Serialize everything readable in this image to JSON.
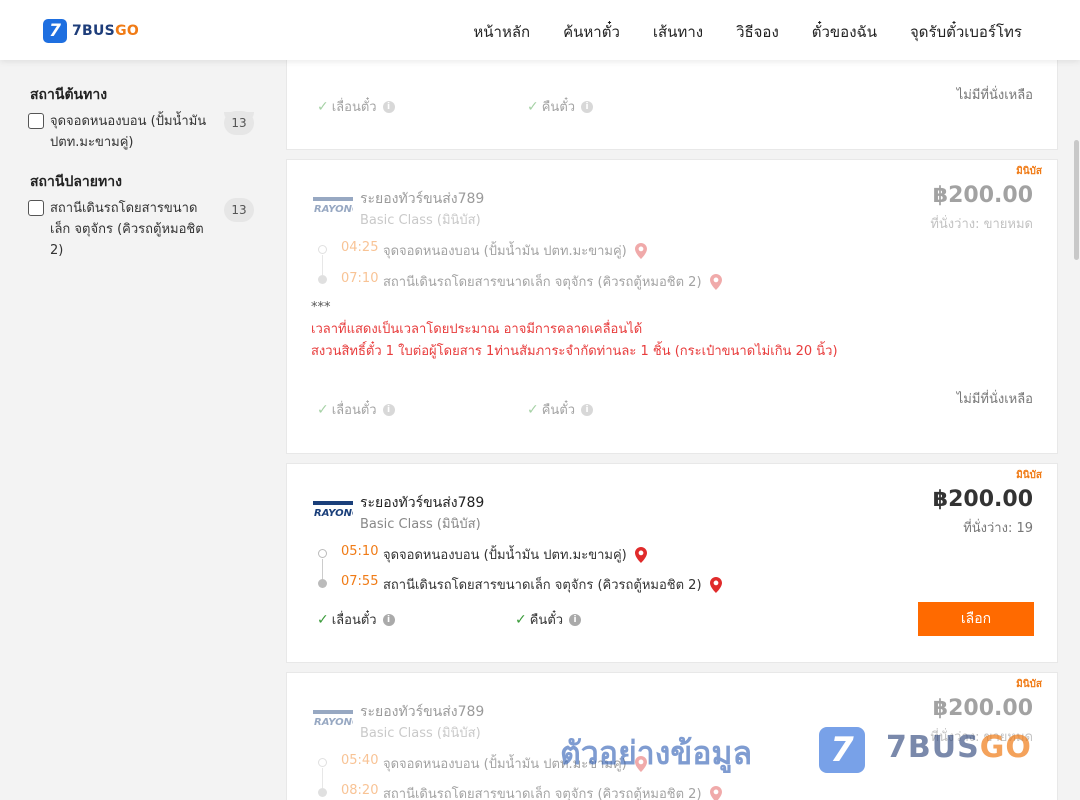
{
  "header": {
    "logo_text_main": "7BUS",
    "logo_text_accent": "GO",
    "logo_badge": "7",
    "nav": [
      "หน้าหลัก",
      "ค้นหาตั๋ว",
      "เส้นทาง",
      "วิธีจอง",
      "ตั๋วของฉัน",
      "จุดรับตั๋วเบอร์โทร"
    ]
  },
  "sidebar": {
    "origin_title": "สถานีต้นทาง",
    "origin_option": "จุดจอดหนองบอน (ปั้มน้ำมัน ปตท.มะขามคู่)",
    "origin_count": "13",
    "dest_title": "สถานีปลายทาง",
    "dest_option": "สถานีเดินรถโดยสารขนาดเล็ก จตุจักร (คิวรถตู้หมอชิต 2)",
    "dest_count": "13"
  },
  "cards": [
    {
      "reschedule": "เลื่อนตั๋ว",
      "refund": "คืนตั๋ว",
      "seat_status": "ไม่มีที่นั่งเหลือ"
    },
    {
      "badge": "มินิบัส",
      "operator": "ระยองทัวร์ขนส่ง789",
      "class": "Basic Class (มินิบัส)",
      "price": "฿200.00",
      "seats": "ที่นั่งว่าง: ขายหมด",
      "depart_time": "04:25",
      "depart_stop": "จุดจอดหนองบอน (ปั้มน้ำมัน ปตท.มะขามคู่)",
      "arrive_time": "07:10",
      "arrive_stop": "สถานีเดินรถโดยสารขนาดเล็ก จตุจักร (คิวรถตู้หมอชิต 2)",
      "note_stars": "***",
      "note_line1": "เวลาที่แสดงเป็นเวลาโดยประมาณ อาจมีการคลาดเคลื่อนได้",
      "note_line2": "สงวนสิทธิ์ตั๋ว 1 ใบต่อผู้โดยสาร 1ท่านสัมภาระจำกัดท่านละ 1 ชิ้น (กระเป๋าขนาดไม่เกิน 20 นิ้ว)",
      "reschedule": "เลื่อนตั๋ว",
      "refund": "คืนตั๋ว",
      "seat_status": "ไม่มีที่นั่งเหลือ"
    },
    {
      "badge": "มินิบัส",
      "operator": "ระยองทัวร์ขนส่ง789",
      "class": "Basic Class (มินิบัส)",
      "price": "฿200.00",
      "seats": "ที่นั่งว่าง: 19",
      "depart_time": "05:10",
      "depart_stop": "จุดจอดหนองบอน (ปั้มน้ำมัน ปตท.มะขามคู่)",
      "arrive_time": "07:55",
      "arrive_stop": "สถานีเดินรถโดยสารขนาดเล็ก จตุจักร (คิวรถตู้หมอชิต 2)",
      "reschedule": "เลื่อนตั๋ว",
      "refund": "คืนตั๋ว",
      "select_label": "เลือก"
    },
    {
      "badge": "มินิบัส",
      "operator": "ระยองทัวร์ขนส่ง789",
      "class": "Basic Class (มินิบัส)",
      "price": "฿200.00",
      "seats": "ที่นั่งว่าง: ขายหมด",
      "depart_time": "05:40",
      "depart_stop": "จุดจอดหนองบอน (ปั้มน้ำมัน ปตท.มะขามคู่)",
      "arrive_time": "08:20",
      "arrive_stop": "สถานีเดินรถโดยสารขนาดเล็ก จตุจักร (คิวรถตู้หมอชิต 2)"
    }
  ],
  "operator_logo_text": "RAYONG",
  "watermark": {
    "text": "ตัวอย่างข้อมูล",
    "badge": "7",
    "brand_main": "7BUS",
    "brand_accent": "GO"
  },
  "colors": {
    "accent": "#ff6a00",
    "brand_blue": "#1e6fe0",
    "note_red": "#e83c3c",
    "time_orange": "#f07b16",
    "check_green": "#3a9b3a"
  },
  "icons": [
    "check-icon",
    "info-icon",
    "location-pin-icon",
    "checkbox-icon"
  ]
}
